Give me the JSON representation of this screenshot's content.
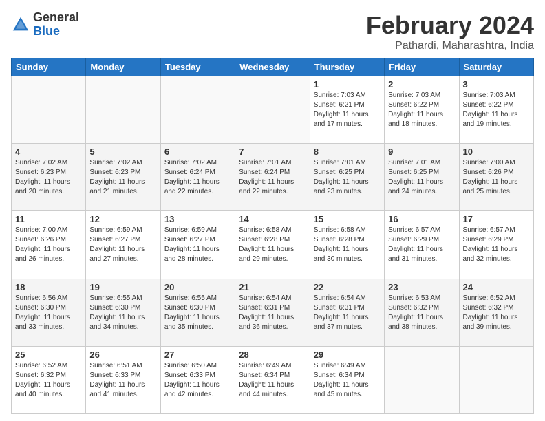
{
  "header": {
    "logo_general": "General",
    "logo_blue": "Blue",
    "month_title": "February 2024",
    "location": "Pathardi, Maharashtra, India"
  },
  "days_of_week": [
    "Sunday",
    "Monday",
    "Tuesday",
    "Wednesday",
    "Thursday",
    "Friday",
    "Saturday"
  ],
  "weeks": [
    [
      {
        "day": "",
        "empty": true
      },
      {
        "day": "",
        "empty": true
      },
      {
        "day": "",
        "empty": true
      },
      {
        "day": "",
        "empty": true
      },
      {
        "day": "1",
        "sunrise": "7:03 AM",
        "sunset": "6:21 PM",
        "daylight": "11 hours and 17 minutes."
      },
      {
        "day": "2",
        "sunrise": "7:03 AM",
        "sunset": "6:22 PM",
        "daylight": "11 hours and 18 minutes."
      },
      {
        "day": "3",
        "sunrise": "7:03 AM",
        "sunset": "6:22 PM",
        "daylight": "11 hours and 19 minutes."
      }
    ],
    [
      {
        "day": "4",
        "sunrise": "7:02 AM",
        "sunset": "6:23 PM",
        "daylight": "11 hours and 20 minutes."
      },
      {
        "day": "5",
        "sunrise": "7:02 AM",
        "sunset": "6:23 PM",
        "daylight": "11 hours and 21 minutes."
      },
      {
        "day": "6",
        "sunrise": "7:02 AM",
        "sunset": "6:24 PM",
        "daylight": "11 hours and 22 minutes."
      },
      {
        "day": "7",
        "sunrise": "7:01 AM",
        "sunset": "6:24 PM",
        "daylight": "11 hours and 22 minutes."
      },
      {
        "day": "8",
        "sunrise": "7:01 AM",
        "sunset": "6:25 PM",
        "daylight": "11 hours and 23 minutes."
      },
      {
        "day": "9",
        "sunrise": "7:01 AM",
        "sunset": "6:25 PM",
        "daylight": "11 hours and 24 minutes."
      },
      {
        "day": "10",
        "sunrise": "7:00 AM",
        "sunset": "6:26 PM",
        "daylight": "11 hours and 25 minutes."
      }
    ],
    [
      {
        "day": "11",
        "sunrise": "7:00 AM",
        "sunset": "6:26 PM",
        "daylight": "11 hours and 26 minutes."
      },
      {
        "day": "12",
        "sunrise": "6:59 AM",
        "sunset": "6:27 PM",
        "daylight": "11 hours and 27 minutes."
      },
      {
        "day": "13",
        "sunrise": "6:59 AM",
        "sunset": "6:27 PM",
        "daylight": "11 hours and 28 minutes."
      },
      {
        "day": "14",
        "sunrise": "6:58 AM",
        "sunset": "6:28 PM",
        "daylight": "11 hours and 29 minutes."
      },
      {
        "day": "15",
        "sunrise": "6:58 AM",
        "sunset": "6:28 PM",
        "daylight": "11 hours and 30 minutes."
      },
      {
        "day": "16",
        "sunrise": "6:57 AM",
        "sunset": "6:29 PM",
        "daylight": "11 hours and 31 minutes."
      },
      {
        "day": "17",
        "sunrise": "6:57 AM",
        "sunset": "6:29 PM",
        "daylight": "11 hours and 32 minutes."
      }
    ],
    [
      {
        "day": "18",
        "sunrise": "6:56 AM",
        "sunset": "6:30 PM",
        "daylight": "11 hours and 33 minutes."
      },
      {
        "day": "19",
        "sunrise": "6:55 AM",
        "sunset": "6:30 PM",
        "daylight": "11 hours and 34 minutes."
      },
      {
        "day": "20",
        "sunrise": "6:55 AM",
        "sunset": "6:30 PM",
        "daylight": "11 hours and 35 minutes."
      },
      {
        "day": "21",
        "sunrise": "6:54 AM",
        "sunset": "6:31 PM",
        "daylight": "11 hours and 36 minutes."
      },
      {
        "day": "22",
        "sunrise": "6:54 AM",
        "sunset": "6:31 PM",
        "daylight": "11 hours and 37 minutes."
      },
      {
        "day": "23",
        "sunrise": "6:53 AM",
        "sunset": "6:32 PM",
        "daylight": "11 hours and 38 minutes."
      },
      {
        "day": "24",
        "sunrise": "6:52 AM",
        "sunset": "6:32 PM",
        "daylight": "11 hours and 39 minutes."
      }
    ],
    [
      {
        "day": "25",
        "sunrise": "6:52 AM",
        "sunset": "6:32 PM",
        "daylight": "11 hours and 40 minutes."
      },
      {
        "day": "26",
        "sunrise": "6:51 AM",
        "sunset": "6:33 PM",
        "daylight": "11 hours and 41 minutes."
      },
      {
        "day": "27",
        "sunrise": "6:50 AM",
        "sunset": "6:33 PM",
        "daylight": "11 hours and 42 minutes."
      },
      {
        "day": "28",
        "sunrise": "6:49 AM",
        "sunset": "6:34 PM",
        "daylight": "11 hours and 44 minutes."
      },
      {
        "day": "29",
        "sunrise": "6:49 AM",
        "sunset": "6:34 PM",
        "daylight": "11 hours and 45 minutes."
      },
      {
        "day": "",
        "empty": true
      },
      {
        "day": "",
        "empty": true
      }
    ]
  ]
}
